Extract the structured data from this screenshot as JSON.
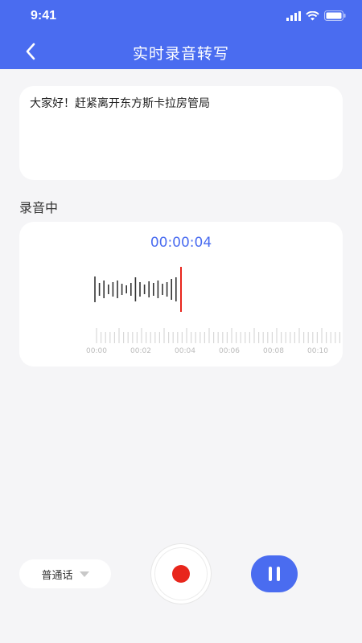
{
  "status": {
    "time": "9:41"
  },
  "nav": {
    "title": "实时录音转写"
  },
  "transcript": {
    "text": "大家好！赶紧离开东方斯卡拉房管局"
  },
  "recording": {
    "status_label": "录音中",
    "timer": "00:00:04",
    "ruler_labels": [
      "00:00",
      "00:02",
      "00:04",
      "00:06",
      "00:08",
      "00:10"
    ]
  },
  "controls": {
    "language": "普通话"
  },
  "colors": {
    "accent": "#4a6cf0",
    "record": "#e8261c",
    "cursor": "#e8261c"
  }
}
